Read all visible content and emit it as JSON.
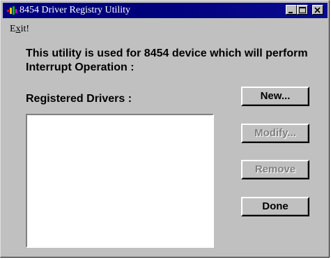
{
  "window": {
    "title": "8454 Driver Registry Utility",
    "icon": "app-logo-icon"
  },
  "menu": {
    "exit_prefix": "E",
    "exit_underlined": "x",
    "exit_suffix": "it!"
  },
  "content": {
    "description": "This utility is used for 8454 device which will perform Interrupt Operation :",
    "registered_label": "Registered Drivers :"
  },
  "buttons": {
    "new": "New...",
    "modify": "Modify...",
    "remove": "Remove",
    "done": "Done"
  },
  "state": {
    "modify_enabled": false,
    "remove_enabled": false
  },
  "drivers": []
}
